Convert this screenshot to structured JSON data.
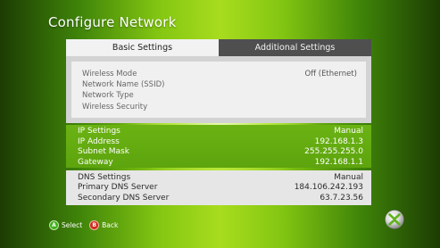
{
  "header": {
    "title": "Configure Network"
  },
  "tabs": [
    {
      "label": "Basic Settings",
      "selected": true
    },
    {
      "label": "Additional Settings",
      "selected": false
    }
  ],
  "wireless": {
    "rows": [
      {
        "label": "Wireless Mode",
        "value": "Off (Ethernet)"
      },
      {
        "label": "Network Name (SSID)",
        "value": ""
      },
      {
        "label": "Network Type",
        "value": ""
      },
      {
        "label": "Wireless Security",
        "value": ""
      }
    ]
  },
  "ip": {
    "rows": [
      {
        "label": "IP Settings",
        "value": "Manual"
      },
      {
        "label": "IP Address",
        "value": "192.168.1.3"
      },
      {
        "label": "Subnet Mask",
        "value": "255.255.255.0"
      },
      {
        "label": "Gateway",
        "value": "192.168.1.1"
      }
    ]
  },
  "dns": {
    "rows": [
      {
        "label": "DNS Settings",
        "value": "Manual"
      },
      {
        "label": "Primary DNS Server",
        "value": "184.106.242.193"
      },
      {
        "label": "Secondary DNS Server",
        "value": "63.7.23.56"
      }
    ]
  },
  "footer": {
    "select_key": "A",
    "select_label": "Select",
    "back_key": "B",
    "back_label": "Back"
  },
  "colors": {
    "accent_green": "#6bb313",
    "button_a": "#3fb01c",
    "button_b": "#d12b1c"
  },
  "icons": {
    "logo": "xbox-logo-icon"
  }
}
